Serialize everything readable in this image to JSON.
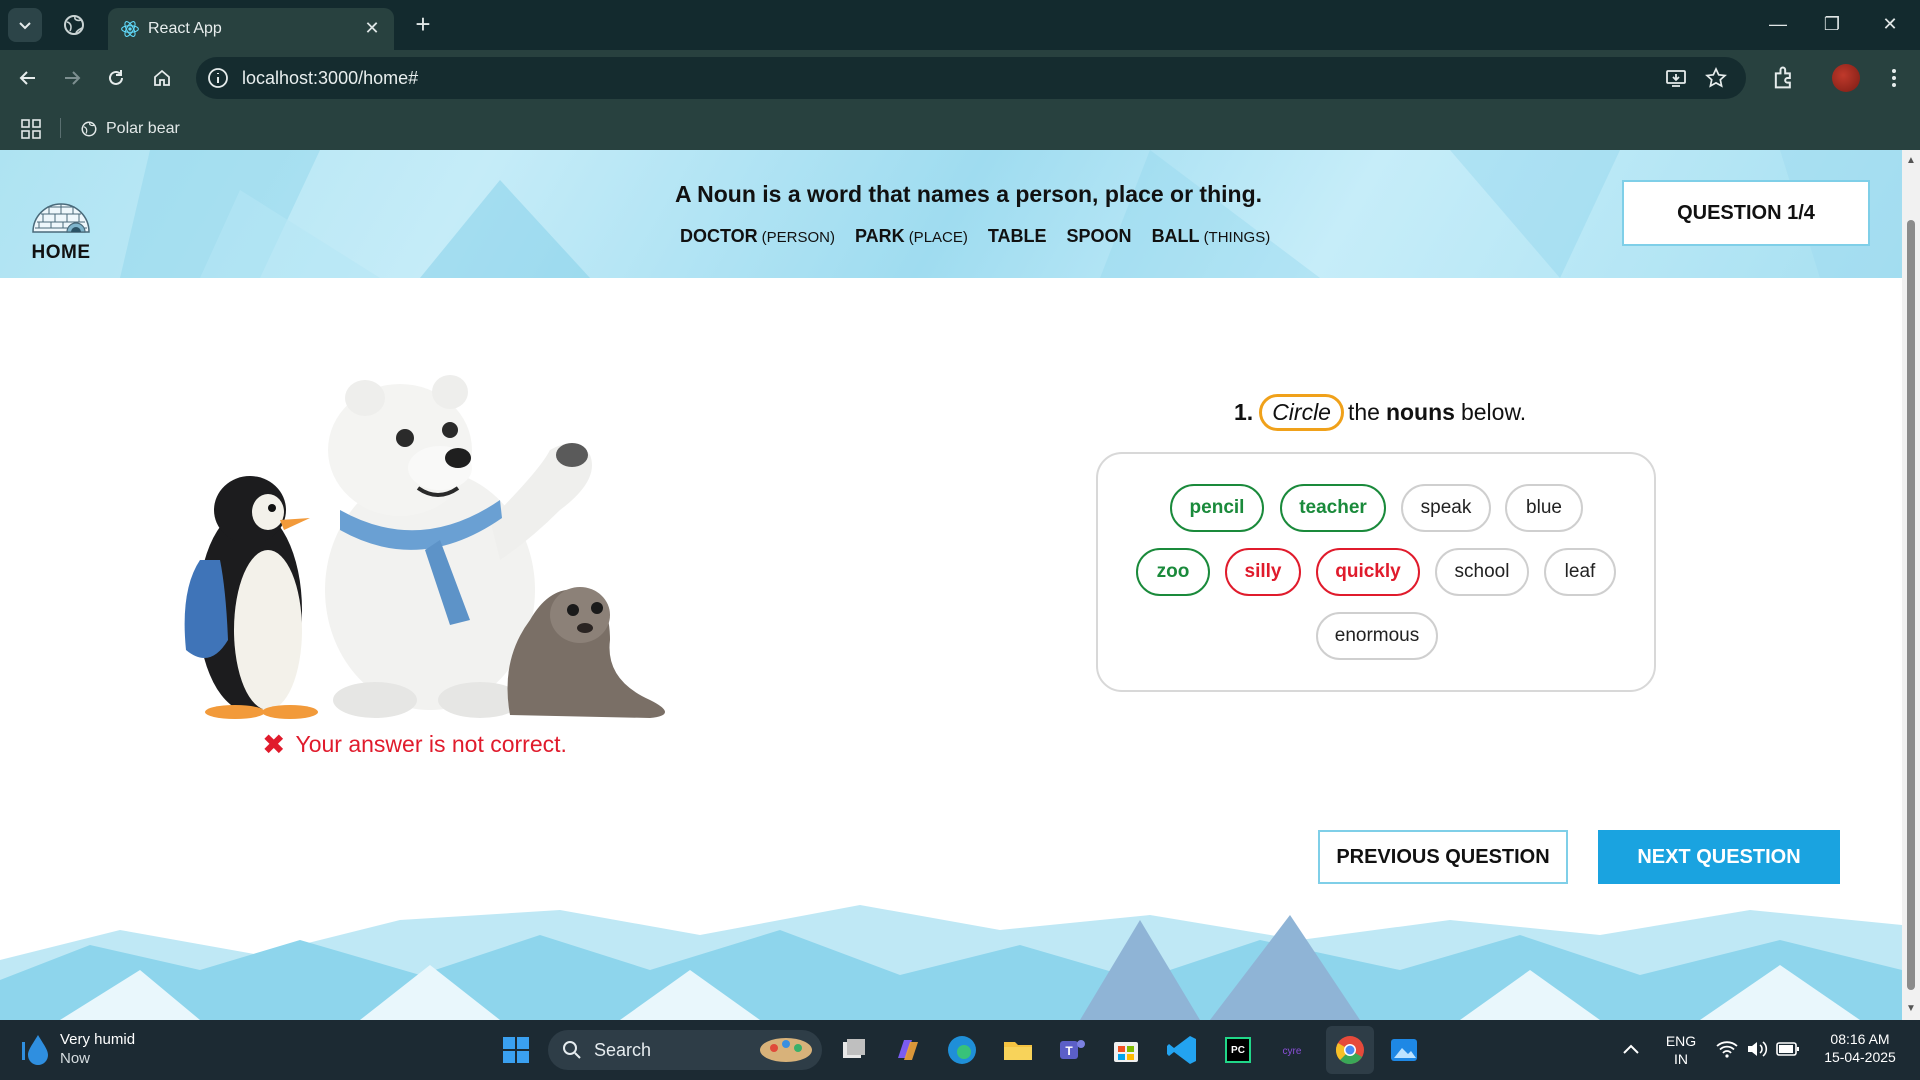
{
  "browser": {
    "tab_title": "React App",
    "url": "localhost:3000/home#",
    "bookmark": "Polar bear"
  },
  "header": {
    "home_label": "HOME",
    "definition": "A Noun is a word that names a person, place or thing.",
    "examples": [
      {
        "word": "DOCTOR",
        "category": "(PERSON)"
      },
      {
        "word": "PARK",
        "category": "(PLACE)"
      },
      {
        "word": "TABLE",
        "category": ""
      },
      {
        "word": "SPOON",
        "category": ""
      },
      {
        "word": "BALL",
        "category": "(THINGS)"
      }
    ],
    "question_counter": "QUESTION 1/4"
  },
  "question": {
    "number": "1.",
    "circle_word": "Circle",
    "text_before": "the",
    "bold_word": "nouns",
    "text_after": "below.",
    "choices": [
      {
        "label": "pencil",
        "state": "correct"
      },
      {
        "label": "teacher",
        "state": "correct"
      },
      {
        "label": "speak",
        "state": "none"
      },
      {
        "label": "blue",
        "state": "none"
      },
      {
        "label": "zoo",
        "state": "correct"
      },
      {
        "label": "silly",
        "state": "wrong"
      },
      {
        "label": "quickly",
        "state": "wrong"
      },
      {
        "label": "school",
        "state": "none"
      },
      {
        "label": "leaf",
        "state": "none"
      },
      {
        "label": "enormous",
        "state": "none"
      }
    ]
  },
  "feedback": {
    "icon": "x-icon",
    "message": "Your answer is not correct.",
    "color": "#e01b2c"
  },
  "navigation": {
    "previous_label": "PREVIOUS QUESTION",
    "next_label": "NEXT QUESTION",
    "accent_color": "#1aa3e0"
  },
  "taskbar": {
    "weather_title": "Very humid",
    "weather_sub": "Now",
    "search_label": "Search",
    "lang_top": "ENG",
    "lang_bottom": "IN",
    "time": "08:16 AM",
    "date": "15-04-2025"
  }
}
